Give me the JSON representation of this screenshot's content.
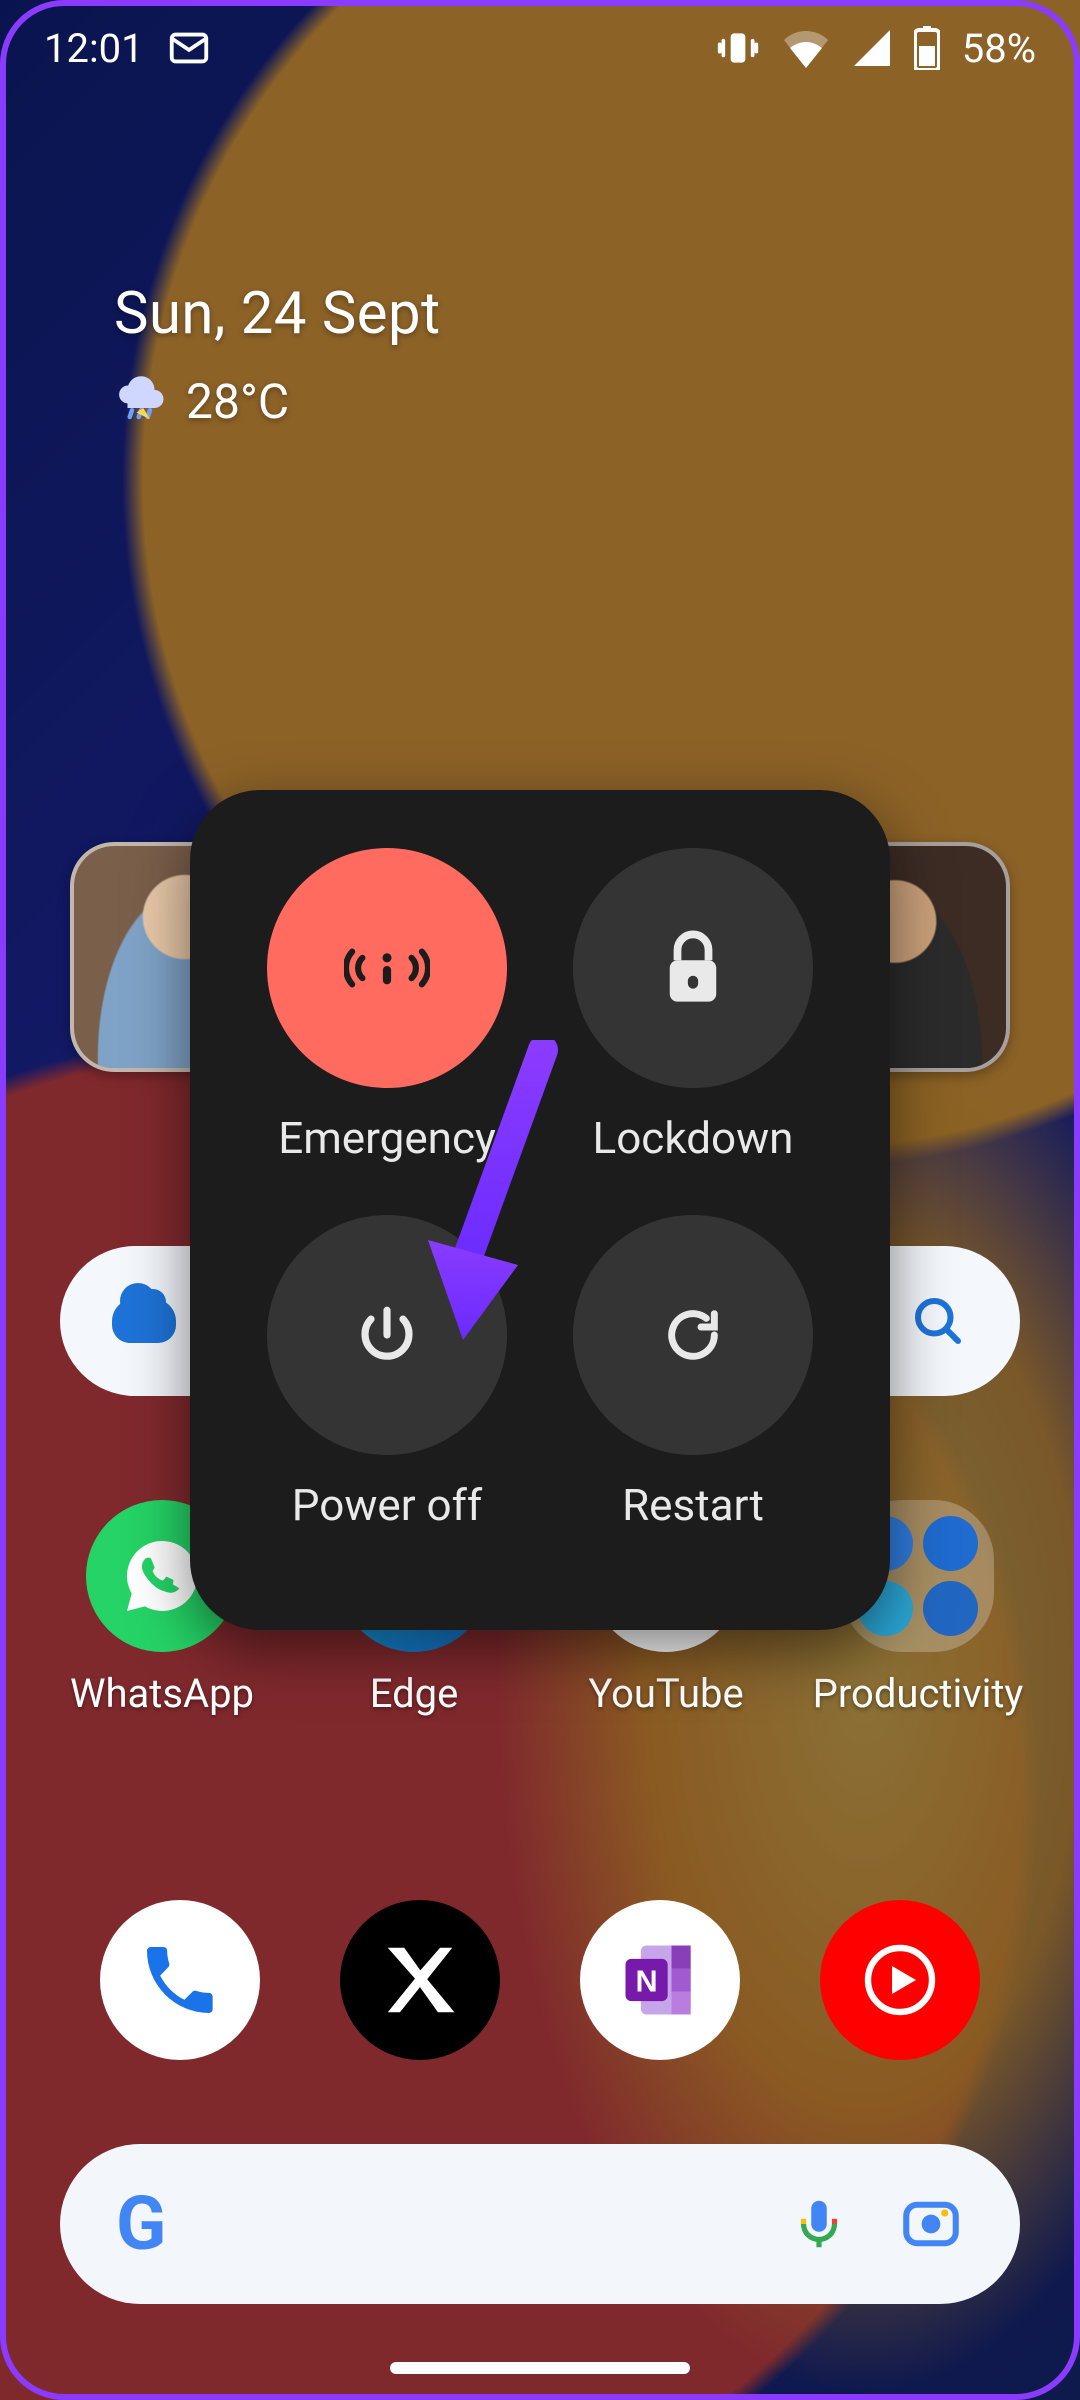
{
  "status_bar": {
    "time": "12:01",
    "battery_text": "58%"
  },
  "widget": {
    "date": "Sun, 24 Sept",
    "temperature": "28°C"
  },
  "behind_apps": {
    "whatsapp": "WhatsApp",
    "edge": "Edge",
    "youtube": "YouTube",
    "productivity": "Productivity"
  },
  "power_menu": {
    "emergency": "Emergency",
    "lockdown": "Lockdown",
    "power_off": "Power off",
    "restart": "Restart"
  },
  "colors": {
    "emergency_bg": "#ff6b5e",
    "menu_bg": "#1c1c1c",
    "menu_btn_bg": "#343434",
    "arrow": "#7b3bff"
  }
}
